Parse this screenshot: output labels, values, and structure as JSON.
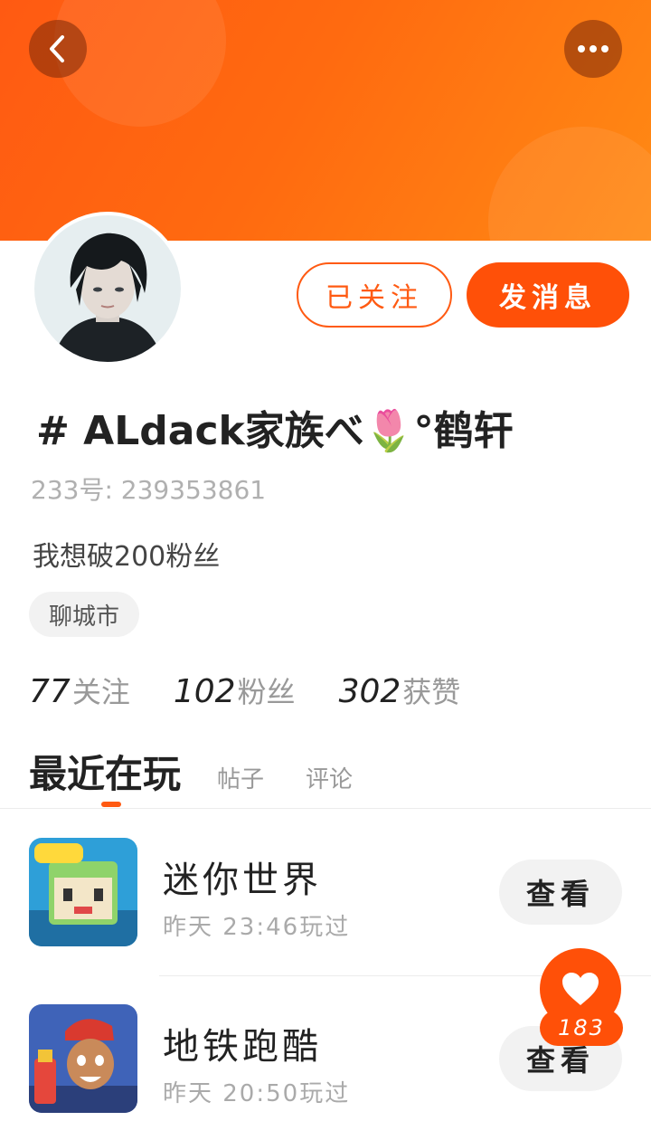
{
  "header": {
    "back_icon": "chevron-left-icon",
    "more_icon": "more-dots-icon"
  },
  "profile": {
    "name": "# ALdack家族べ🌷°鹤轩",
    "uid": "233号:  239353861",
    "bio": "我想破200粉丝",
    "city": "聊城市",
    "follow_button": "已关注",
    "message_button": "发消息"
  },
  "stats": [
    {
      "value": "77",
      "label": "关注"
    },
    {
      "value": "102",
      "label": "粉丝"
    },
    {
      "value": "302",
      "label": "获赞"
    }
  ],
  "tabs": [
    {
      "label": "最近在玩",
      "active": true
    },
    {
      "label": "帖子",
      "active": false
    },
    {
      "label": "评论",
      "active": false
    }
  ],
  "games": [
    {
      "name": "迷你世界",
      "time": "昨天 23:46玩过",
      "button": "查看",
      "icon": "mini-world-game-icon"
    },
    {
      "name": "地铁跑酷",
      "time": "昨天 20:50玩过",
      "button": "查看",
      "icon": "subway-surfers-game-icon"
    }
  ],
  "likes": {
    "count": "183",
    "icon": "heart-icon"
  },
  "colors": {
    "accent": "#ff5a12",
    "banner_end": "#ff8a14"
  }
}
